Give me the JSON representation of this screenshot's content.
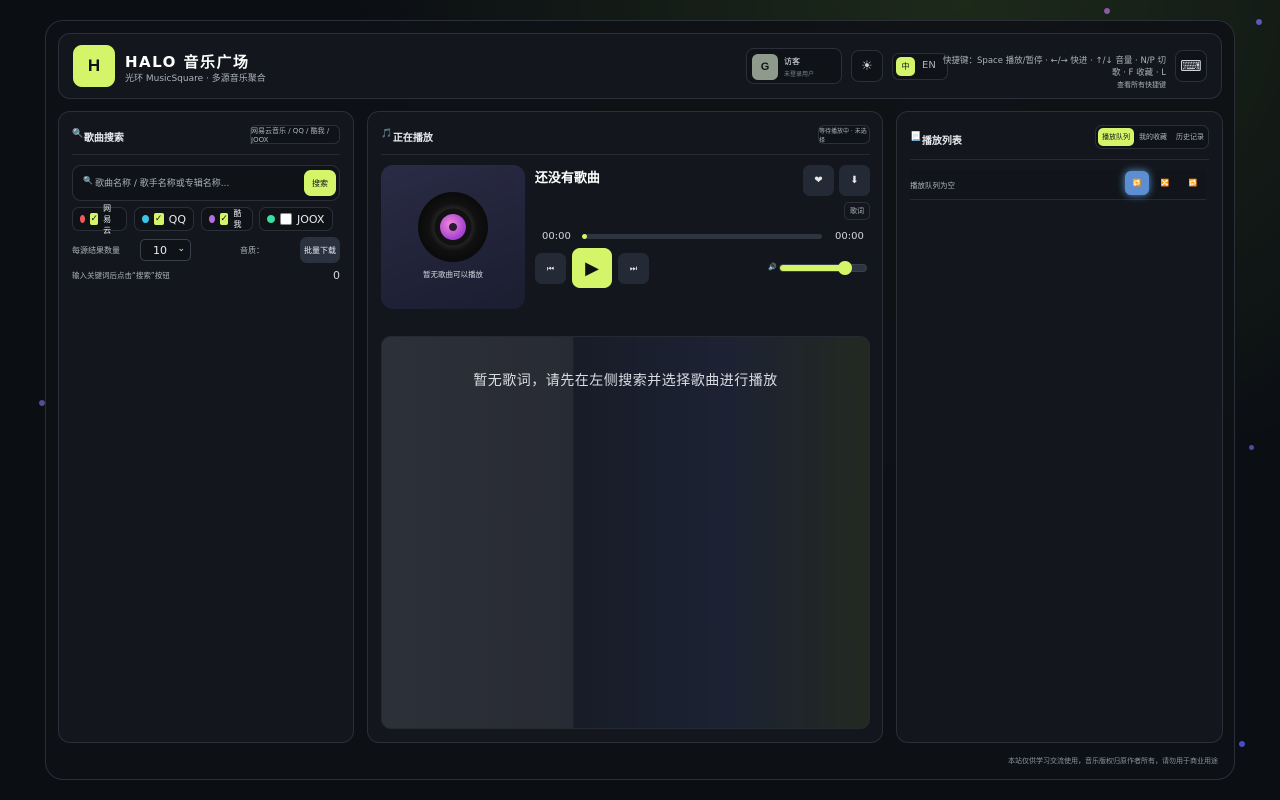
{
  "header": {
    "logo_letter": "H",
    "title": "HALO 音乐广场",
    "subtitle": "光环 MusicSquare · 多源音乐聚合",
    "user": {
      "avatar_letter": "G",
      "name": "访客",
      "status": "未登录用户"
    },
    "theme_icon": "☀",
    "lang_zh": "中",
    "lang_en": "EN",
    "shortcuts_line1": "快捷键：Space 播放/暂停 · ←/→ 快进 · ↑/↓ 音量 · N/P 切歌 · F 收藏 · L",
    "shortcuts_line2": "查看所有快捷键",
    "keyboard_icon": "⌨"
  },
  "search_panel": {
    "title_icon": "🔍",
    "title": "歌曲搜索",
    "sources_pill": "网易云音乐 / QQ / 酷我 / JOOX",
    "search_icon": "🔍",
    "search_placeholder": "歌曲名称 / 歌手名称或专辑名称...",
    "search_button": "搜索",
    "sources": [
      {
        "label": "网易云",
        "color": "#f05a5a",
        "checked": true
      },
      {
        "label": "QQ",
        "color": "#37c5e8",
        "checked": true
      },
      {
        "label": "酷我",
        "color": "#b46ee0",
        "checked": true
      },
      {
        "label": "JOOX",
        "color": "#38e0a0",
        "checked": false
      }
    ],
    "count_label": "每源结果数量",
    "count_value": "10",
    "quality_label": "音质：",
    "batch_button": "批量下载",
    "result_hint": "输入关键词后点击“搜索”按钮",
    "result_count": "0"
  },
  "player_panel": {
    "title_icon": "🎵",
    "title": "正在播放",
    "status_pill": "等待播放中 · 未选择",
    "cover_caption": "暂无歌曲可以播放",
    "track_title": "还没有歌曲",
    "like_icon": "❤",
    "download_icon": "⬇",
    "lyrics_tag": "歌词",
    "time_current": "00:00",
    "time_total": "00:00",
    "progress": 0.02,
    "prev_icon": "⏮",
    "play_icon": "▶",
    "next_icon": "⏭",
    "volume_icon": "🔊",
    "volume": 0.75,
    "lyrics_placeholder": "暂无歌词，请先在左侧搜索并选择歌曲进行播放"
  },
  "list_panel": {
    "title_icon": "📃",
    "title": "播放列表",
    "tabs": [
      "播放队列",
      "我的收藏",
      "历史记录"
    ],
    "queue_label": "播放队列为空",
    "mode_icons": [
      "🔁",
      "🔀",
      "🔂"
    ]
  },
  "footer": {
    "note": "本站仅供学习交流使用，音乐版权归原作者所有，请勿用于商业用途"
  }
}
